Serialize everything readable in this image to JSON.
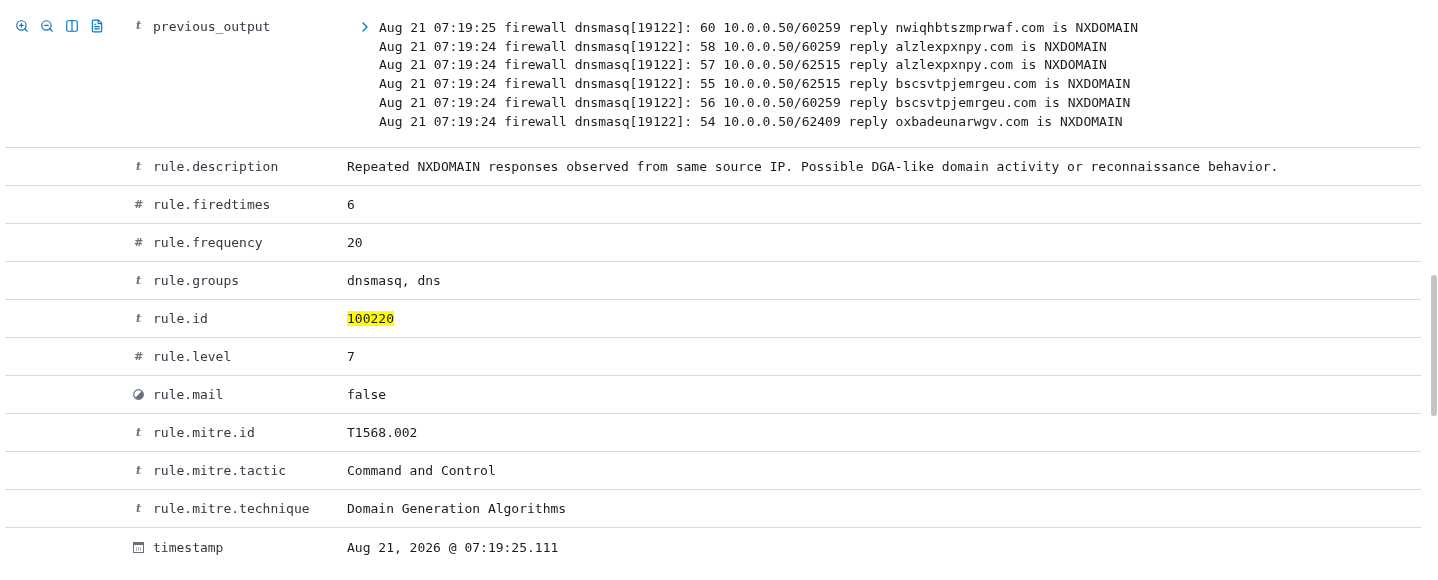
{
  "fields": [
    {
      "name": "previous_output",
      "kind": "glyph",
      "glyph": "t",
      "lines": [
        "Aug 21 07:19:25 firewall dnsmasq[19122]: 60 10.0.0.50/60259 reply nwiqhbtszmprwaf.com is NXDOMAIN",
        "Aug 21 07:19:24 firewall dnsmasq[19122]: 58 10.0.0.50/60259 reply alzlexpxnpy.com is NXDOMAIN",
        "Aug 21 07:19:24 firewall dnsmasq[19122]: 57 10.0.0.50/62515 reply alzlexpxnpy.com is NXDOMAIN",
        "Aug 21 07:19:24 firewall dnsmasq[19122]: 55 10.0.0.50/62515 reply bscsvtpjemrgeu.com is NXDOMAIN",
        "Aug 21 07:19:24 firewall dnsmasq[19122]: 56 10.0.0.50/60259 reply bscsvtpjemrgeu.com is NXDOMAIN",
        "Aug 21 07:19:24 firewall dnsmasq[19122]: 54 10.0.0.50/62409 reply oxbadeunarwgv.com is NXDOMAIN"
      ]
    },
    {
      "name": "rule.description",
      "kind": "glyph",
      "glyph": "t",
      "value": "Repeated NXDOMAIN responses observed from same source IP. Possible DGA-like domain activity or reconnaissance behavior."
    },
    {
      "name": "rule.firedtimes",
      "kind": "glyph",
      "glyph": "#",
      "value": "6"
    },
    {
      "name": "rule.frequency",
      "kind": "glyph",
      "glyph": "#",
      "value": "20"
    },
    {
      "name": "rule.groups",
      "kind": "glyph",
      "glyph": "t",
      "value": "dnsmasq, dns"
    },
    {
      "name": "rule.id",
      "kind": "glyph",
      "glyph": "t",
      "value": "100220",
      "highlighted": true
    },
    {
      "name": "rule.level",
      "kind": "glyph",
      "glyph": "#",
      "value": "7"
    },
    {
      "name": "rule.mail",
      "kind": "boolean",
      "value": "false"
    },
    {
      "name": "rule.mitre.id",
      "kind": "glyph",
      "glyph": "t",
      "value": "T1568.002"
    },
    {
      "name": "rule.mitre.tactic",
      "kind": "glyph",
      "glyph": "t",
      "value": "Command and Control"
    },
    {
      "name": "rule.mitre.technique",
      "kind": "glyph",
      "glyph": "t",
      "value": "Domain Generation Algorithms"
    },
    {
      "name": "timestamp",
      "kind": "date",
      "value": "Aug 21, 2026 @ 07:19:25.111"
    }
  ]
}
